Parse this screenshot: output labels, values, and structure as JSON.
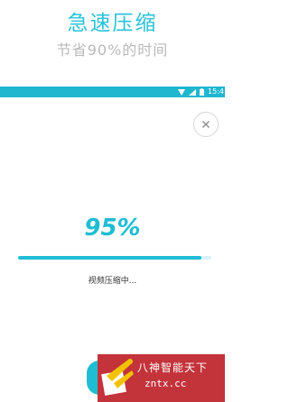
{
  "promo": {
    "title": "急速压缩",
    "subtitle": "节省90%的时间"
  },
  "status_bar": {
    "time": "15:4",
    "background": "#1fb7d0"
  },
  "close_button": {
    "icon": "close-icon",
    "glyph": "×"
  },
  "compression": {
    "progress_label": "95%",
    "progress_fraction": 0.95,
    "status_text": "视频压缩中..."
  },
  "watermark": {
    "name": "八神智能天下",
    "domain": "zntx.cc"
  },
  "colors": {
    "accent": "#1fbdd4",
    "watermark_bg": "#c3333a"
  }
}
